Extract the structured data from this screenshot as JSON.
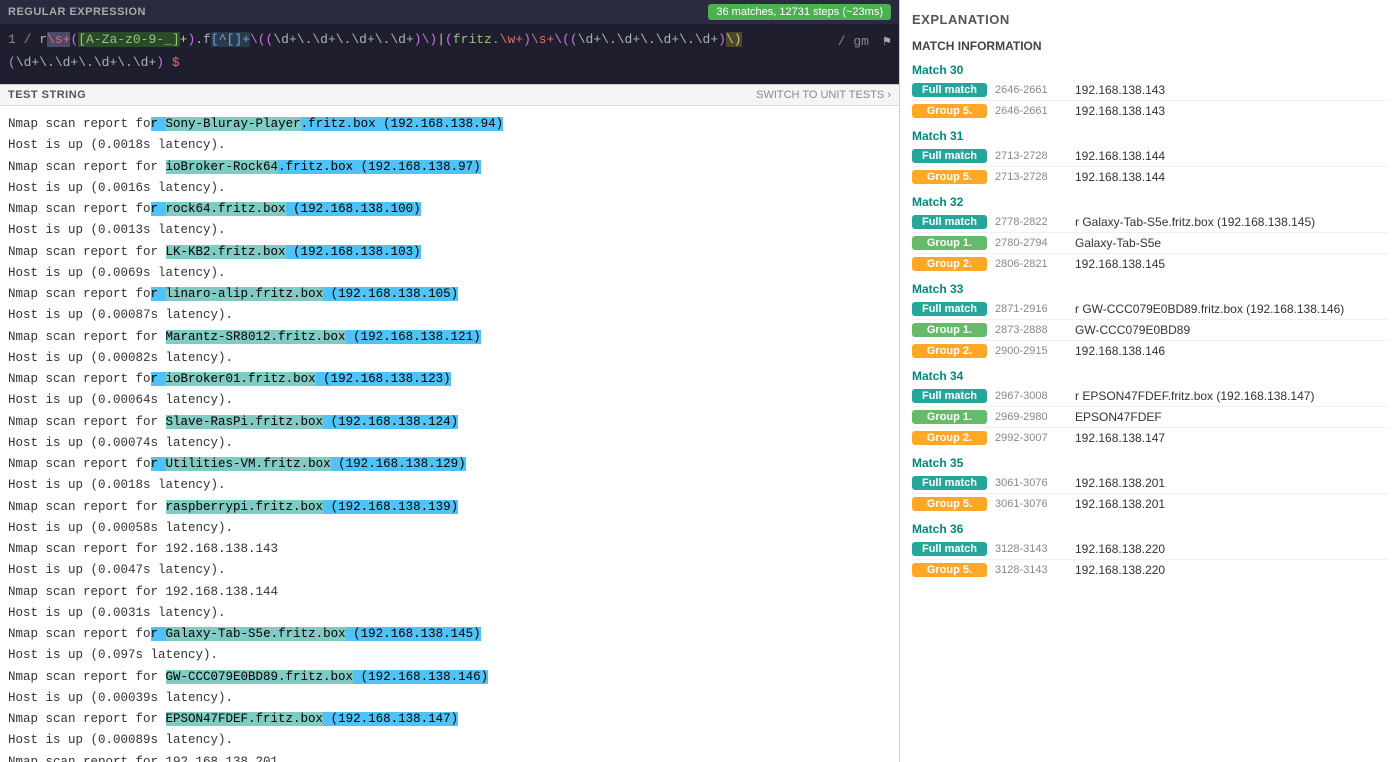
{
  "regex_header": {
    "title": "REGULAR EXPRESSION",
    "stats": "36 matches, 12731 steps (~23ms)",
    "flags": "/ gm",
    "pattern_display": "r\\s+([A-Za-z0-9-_]+)\\.f[^[]+\\((\\d+\\.\\d+\\.\\d+\\.\\d+)\\)|(fritz\\.\\w+)\\s+\\((\\d+\\.\\d+\\.\\d+\\.\\d+)\\)"
  },
  "test_header": {
    "title": "TEST STRING",
    "switch_label": "SWITCH TO UNIT TESTS"
  },
  "right_panel": {
    "explanation_title": "EXPLANATION",
    "match_info_title": "MATCH INFORMATION"
  },
  "matches": [
    {
      "number": "Match 30",
      "rows": [
        {
          "badge": "Full match",
          "badge_type": "full",
          "range": "2646-2661",
          "value": "192.168.138.143"
        },
        {
          "badge": "Group 5.",
          "badge_type": "group5",
          "range": "2646-2661",
          "value": "192.168.138.143"
        }
      ]
    },
    {
      "number": "Match 31",
      "rows": [
        {
          "badge": "Full match",
          "badge_type": "full",
          "range": "2713-2728",
          "value": "192.168.138.144"
        },
        {
          "badge": "Group 5.",
          "badge_type": "group5",
          "range": "2713-2728",
          "value": "192.168.138.144"
        }
      ]
    },
    {
      "number": "Match 32",
      "rows": [
        {
          "badge": "Full match",
          "badge_type": "full",
          "range": "2778-2822",
          "value": "r Galaxy-Tab-S5e.fritz.box (192.168.138.145)"
        },
        {
          "badge": "Group 1.",
          "badge_type": "group1",
          "range": "2780-2794",
          "value": "Galaxy-Tab-S5e"
        },
        {
          "badge": "Group 2.",
          "badge_type": "group2",
          "range": "2806-2821",
          "value": "192.168.138.145"
        }
      ]
    },
    {
      "number": "Match 33",
      "rows": [
        {
          "badge": "Full match",
          "badge_type": "full",
          "range": "2871-2916",
          "value": "r GW-CCC079E0BD89.fritz.box (192.168.138.146)"
        },
        {
          "badge": "Group 1.",
          "badge_type": "group1",
          "range": "2873-2888",
          "value": "GW-CCC079E0BD89"
        },
        {
          "badge": "Group 2.",
          "badge_type": "group2",
          "range": "2900-2915",
          "value": "192.168.138.146"
        }
      ]
    },
    {
      "number": "Match 34",
      "rows": [
        {
          "badge": "Full match",
          "badge_type": "full",
          "range": "2967-3008",
          "value": "r EPSON47FDEF.fritz.box (192.168.138.147)"
        },
        {
          "badge": "Group 1.",
          "badge_type": "group1",
          "range": "2969-2980",
          "value": "EPSON47FDEF"
        },
        {
          "badge": "Group 2.",
          "badge_type": "group2",
          "range": "2992-3007",
          "value": "192.168.138.147"
        }
      ]
    },
    {
      "number": "Match 35",
      "rows": [
        {
          "badge": "Full match",
          "badge_type": "full",
          "range": "3061-3076",
          "value": "192.168.138.201"
        },
        {
          "badge": "Group 5.",
          "badge_type": "group5",
          "range": "3061-3076",
          "value": "192.168.138.201"
        }
      ]
    },
    {
      "number": "Match 36",
      "rows": [
        {
          "badge": "Full match",
          "badge_type": "full",
          "range": "3128-3143",
          "value": "192.168.138.220"
        },
        {
          "badge": "Group 5.",
          "badge_type": "group5",
          "range": "3128-3143",
          "value": "192.168.138.220"
        }
      ]
    }
  ]
}
